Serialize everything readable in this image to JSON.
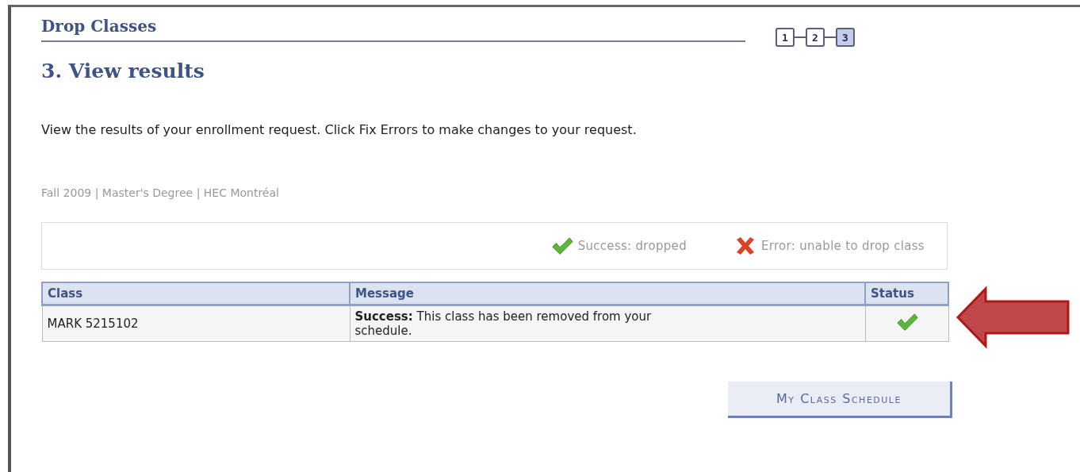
{
  "page": {
    "title": "Drop Classes",
    "subtitle": "3. View results"
  },
  "steps": [
    {
      "label": "1",
      "selected": false
    },
    {
      "label": "2",
      "selected": false
    },
    {
      "label": "3",
      "selected": true
    }
  ],
  "instructions": "View the results of your enrollment request.  Click Fix Errors to make changes to your request.",
  "term_info": "Fall 2009 | Master's Degree | HEC Montréal",
  "legend": [
    {
      "kind": "success",
      "label": "Success: dropped"
    },
    {
      "kind": "error",
      "label": "Error: unable to drop class"
    }
  ],
  "table": {
    "columns": [
      "Class",
      "Message",
      "Status"
    ],
    "rows": [
      {
        "class": "MARK 5215102",
        "message": "**Success:** This class has been removed from your schedule.",
        "kind": "success"
      }
    ]
  },
  "button": "My Class Schedule"
}
